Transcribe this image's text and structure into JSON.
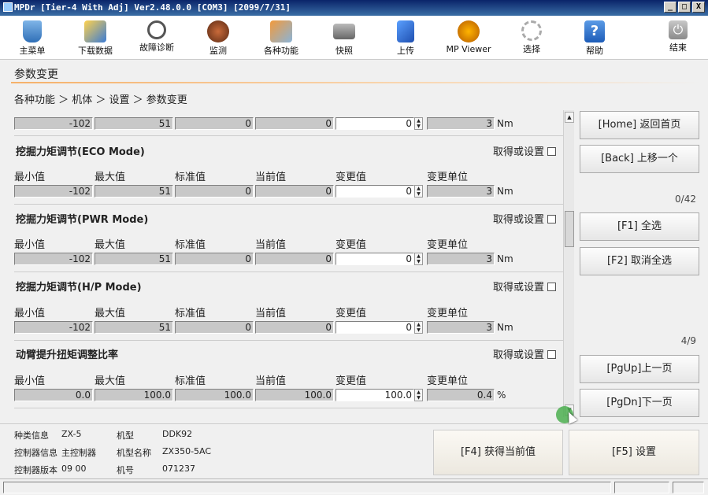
{
  "window": {
    "title": "MPDr [Tier-4 With Adj] Ver2.48.0.0 [COM3] [2099/7/31]",
    "buttons": [
      "_",
      "□",
      "X"
    ]
  },
  "toolbar": [
    {
      "label": "主菜单",
      "icon": "main-menu-icon"
    },
    {
      "label": "下载数据",
      "icon": "download-icon"
    },
    {
      "label": "故障诊断",
      "icon": "stethoscope-icon"
    },
    {
      "label": "监测",
      "icon": "monitor-gauge-icon"
    },
    {
      "label": "各种功能",
      "icon": "functions-icon"
    },
    {
      "label": "快照",
      "icon": "camera-icon"
    },
    {
      "label": "上传",
      "icon": "upload-icon"
    },
    {
      "label": "MP Viewer",
      "icon": "viewer-icon"
    },
    {
      "label": "选择",
      "icon": "select-gear-icon"
    },
    {
      "label": "帮助",
      "icon": "help-icon"
    },
    {
      "label": "结束",
      "icon": "power-icon"
    }
  ],
  "page_title": "参数变更",
  "breadcrumb": "各种功能 ＞ 机体 ＞ 设置 ＞ 参数变更",
  "columns": [
    "最小值",
    "最大值",
    "标准值",
    "当前值",
    "变更值",
    "变更单位"
  ],
  "get_set_label": "取得或设置",
  "top_partial_row": {
    "min": "-102",
    "max": "51",
    "std": "0",
    "cur": "0",
    "chg": "0",
    "step": "3",
    "unit": "Nm"
  },
  "sections": [
    {
      "title": "挖掘力矩调节(ECO Mode)",
      "min": "-102",
      "max": "51",
      "std": "0",
      "cur": "0",
      "chg": "0",
      "step": "3",
      "unit": "Nm"
    },
    {
      "title": "挖掘力矩调节(PWR Mode)",
      "min": "-102",
      "max": "51",
      "std": "0",
      "cur": "0",
      "chg": "0",
      "step": "3",
      "unit": "Nm"
    },
    {
      "title": "挖掘力矩调节(H/P Mode)",
      "min": "-102",
      "max": "51",
      "std": "0",
      "cur": "0",
      "chg": "0",
      "step": "3",
      "unit": "Nm"
    },
    {
      "title": "动臂提升扭矩调整比率",
      "min": "0.0",
      "max": "100.0",
      "std": "100.0",
      "cur": "100.0",
      "chg": "100.0",
      "step": "0.4",
      "unit": "%"
    }
  ],
  "right_buttons": {
    "home": "[Home] 返回首页",
    "back": "[Back] 上移一个",
    "count1": "0/42",
    "f1": "[F1] 全选",
    "f2": "[F2] 取消全选",
    "count2": "4/9",
    "pgup": "[PgUp]上一页",
    "pgdn": "[PgDn]下一页"
  },
  "info": {
    "type_label": "种类信息",
    "type_value": "ZX-5",
    "model_label": "机型",
    "model_value": "DDK92",
    "ctrl_label": "控制器信息",
    "ctrl_value": "主控制器",
    "model_name_label": "机型名称",
    "model_name_value": "ZX350-5AC",
    "ver_label": "控制器版本",
    "ver_value": "09 00",
    "serial_label": "机号",
    "serial_value": "071237"
  },
  "bottom_buttons": {
    "f4": "[F4] 获得当前值",
    "f5": "[F5] 设置"
  }
}
